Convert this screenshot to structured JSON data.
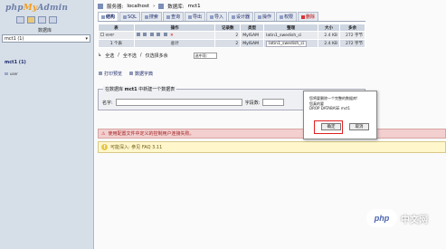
{
  "left_panel": {
    "logo": {
      "prefix": "php",
      "mid": "My",
      "suffix": "Admin"
    },
    "database_label": "数据库",
    "db_select_value": "mct1 (1)",
    "db_name": "mct1 (1)",
    "table_name": "user"
  },
  "breadcrumb": {
    "server_label": "服务器:",
    "server_value": "localhost",
    "db_label": "数据库:",
    "db_value": "mct1"
  },
  "tabs": [
    {
      "label": "结构",
      "active": true
    },
    {
      "label": "SQL"
    },
    {
      "label": "搜索"
    },
    {
      "label": "查询"
    },
    {
      "label": "导出"
    },
    {
      "label": "导入"
    },
    {
      "label": "设计器"
    },
    {
      "label": "操作"
    },
    {
      "label": "权限"
    },
    {
      "label": "删除"
    }
  ],
  "table": {
    "headers": [
      "表",
      "操作",
      "记录数",
      "类型",
      "整理",
      "大小",
      "多余"
    ],
    "rows": [
      {
        "name": "user",
        "records": "2",
        "type": "MyISAM",
        "collation": "latin1_swedish_ci",
        "size": "2.4 KB",
        "overhead": "272 字节"
      }
    ],
    "summary": {
      "count": "1 个表",
      "label": "总计",
      "records": "2",
      "type": "MyISAM",
      "collation": "latin1_swedish_ci",
      "size": "2.4 KB",
      "overhead": "272 字节"
    }
  },
  "select_row": {
    "select_all": "全选",
    "separator": "/",
    "deselect_all": "全不选",
    "select_overhead": "仅选择多余",
    "dropdown": "选中项:"
  },
  "print_row": {
    "print": "打印预览",
    "dictionary": "数据字典"
  },
  "new_table": {
    "legend_prefix": "在数据库",
    "legend_db": "mct1",
    "legend_suffix": "中新建一个数据表",
    "name_label": "名字:",
    "fields_label": "字段数:"
  },
  "warning": "使用配置文件中定义的控制用户连接失败。",
  "notice": "可能深入: 参见 FAQ 3.11",
  "dialog": {
    "line1": "您将要删除一个完整的数据库!",
    "line2": "您真的要",
    "line3": "DROP DATABASE mct1",
    "ok": "确定",
    "cancel": "取消"
  },
  "watermark": {
    "logo": "php",
    "text": "中文网"
  }
}
